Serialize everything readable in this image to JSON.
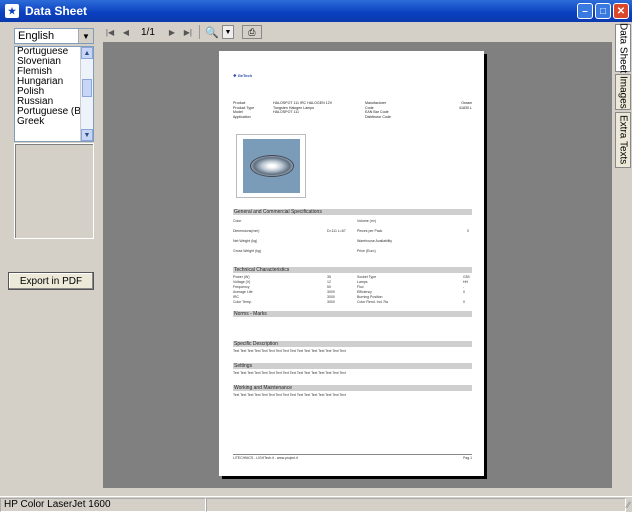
{
  "window": {
    "title": "Data Sheet"
  },
  "language": {
    "selected": "English",
    "options": [
      "Portuguese",
      "Slovenian",
      "Flemish",
      "Hungarian",
      "Polish",
      "Russian",
      "Portuguese (Brazil",
      "Greek"
    ]
  },
  "left_panel": {
    "export_label": "Export in PDF"
  },
  "toolbar": {
    "page_indicator": "1/1"
  },
  "tabs": [
    "Data Sheet",
    "Images",
    "Extra Texts"
  ],
  "statusbar": {
    "printer": "HP Color LaserJet 1600"
  },
  "document": {
    "logo": "❖ GeTech",
    "info_left_labels": [
      "Product",
      "Product Type",
      "Model",
      "Application"
    ],
    "info_left_values": [
      "HALOSPOT 111 IRC HALOGEN 12V",
      "Tungsten Halogen Lamps",
      "HALOSPOT 111",
      ""
    ],
    "info_right_labels": [
      "Manufacturer",
      "Code",
      "EAN Bar Code",
      "Distributor Code"
    ],
    "info_right_values": [
      "Osram",
      "41830 L",
      "",
      ""
    ],
    "sections": {
      "general": "General and Commercial Specifications",
      "technical": "Technical Characteristics",
      "norms": "Norms - Marks",
      "specific": "Specific Description",
      "settings": "Settings",
      "working": "Working and Maintenance"
    },
    "general_rows": [
      {
        "l": "Color",
        "v": "",
        "r": "Volume (m³)",
        "rv": ""
      },
      {
        "l": "Dimensions(mm)",
        "v": "D=111 L=67",
        "r": "Pieces per Pack",
        "rv": "0"
      },
      {
        "l": "Net Weight (kg)",
        "v": "",
        "r": "Warehouse Availability",
        "rv": ""
      },
      {
        "l": "Gross Weight (kg)",
        "v": "",
        "r": "Price (Euro)",
        "rv": ""
      }
    ],
    "tech_rows": [
      {
        "l": "Power (W)",
        "v": "35",
        "r": "Socket Type",
        "rv": "G53"
      },
      {
        "l": "Voltage (V)",
        "v": "12",
        "r": "Lamps",
        "rv": "HH"
      },
      {
        "l": "Frequency",
        "v": "50",
        "r": "Flux",
        "rv": "-"
      },
      {
        "l": "Average Life",
        "v": "3000",
        "r": "Efficiency",
        "rv": "0"
      },
      {
        "l": "IRC",
        "v": "3000",
        "r": "Burning Position",
        "rv": ""
      },
      {
        "l": "Color Temp.",
        "v": "3000",
        "r": "Color Rend. Ind. Ra",
        "rv": "0"
      }
    ],
    "filler_text": "Text Text Text Text Text Text Text Text Text Text Text Text Text Text Text Text",
    "footer_left": "LITECHNICS - LIGHTech.it - www.project.it",
    "footer_right": "Pag.1"
  }
}
